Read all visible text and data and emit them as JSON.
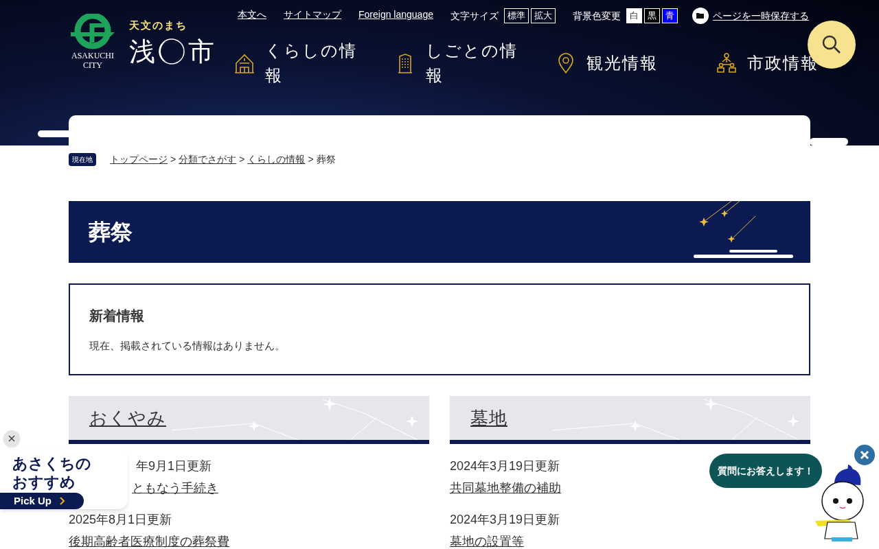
{
  "header": {
    "logo_en": "ASAKUCHI CITY",
    "tagline": "天文のまち",
    "city_name_left": "浅",
    "city_name_right": "市",
    "utility_links": [
      "本文へ",
      "サイトマップ",
      "Foreign language"
    ],
    "font_size": {
      "label": "文字サイズ",
      "options": [
        {
          "label": "標準"
        },
        {
          "label": "拡大"
        }
      ]
    },
    "bg_color": {
      "label": "背景色変更",
      "options": [
        {
          "label": "白",
          "kind": "white"
        },
        {
          "label": "黒",
          "kind": "black"
        },
        {
          "label": "青",
          "kind": "blue"
        }
      ]
    },
    "save_link": "ページを一時保存する",
    "nav": [
      {
        "label": "くらしの情報",
        "kind": "house"
      },
      {
        "label": "しごとの情報",
        "kind": "building"
      },
      {
        "label": "観光情報",
        "kind": "pin"
      },
      {
        "label": "市政情報",
        "kind": "people"
      }
    ]
  },
  "breadcrumb": {
    "badge": "現在地",
    "items": [
      {
        "label": "トップページ",
        "separator": ">"
      },
      {
        "label": "分類でさがす",
        "separator": ">"
      },
      {
        "label": "くらしの情報",
        "separator": ">"
      }
    ],
    "current": "葬祭"
  },
  "page_title": "葬祭",
  "news": {
    "title": "新着情報",
    "message": "現在、掲載されている情報はありません。"
  },
  "sections": [
    {
      "title": "おくやみ",
      "items": [
        {
          "date": "年9月1日更新",
          "link": "ともなう手続き"
        },
        {
          "date": "2025年8月1日更新",
          "link": "後期高齢者医療制度の葬祭費"
        }
      ]
    },
    {
      "title": "墓地",
      "items": [
        {
          "date": "2024年3月19日更新",
          "link": "共同墓地整備の補助"
        },
        {
          "date": "2024年3月19日更新",
          "link": "墓地の設置等"
        }
      ]
    }
  ],
  "pickup": {
    "line1": "あさくちの",
    "line2": "おすすめ",
    "button": "Pick Up"
  },
  "chatbot": {
    "bubble": "質問にお答えします！"
  }
}
